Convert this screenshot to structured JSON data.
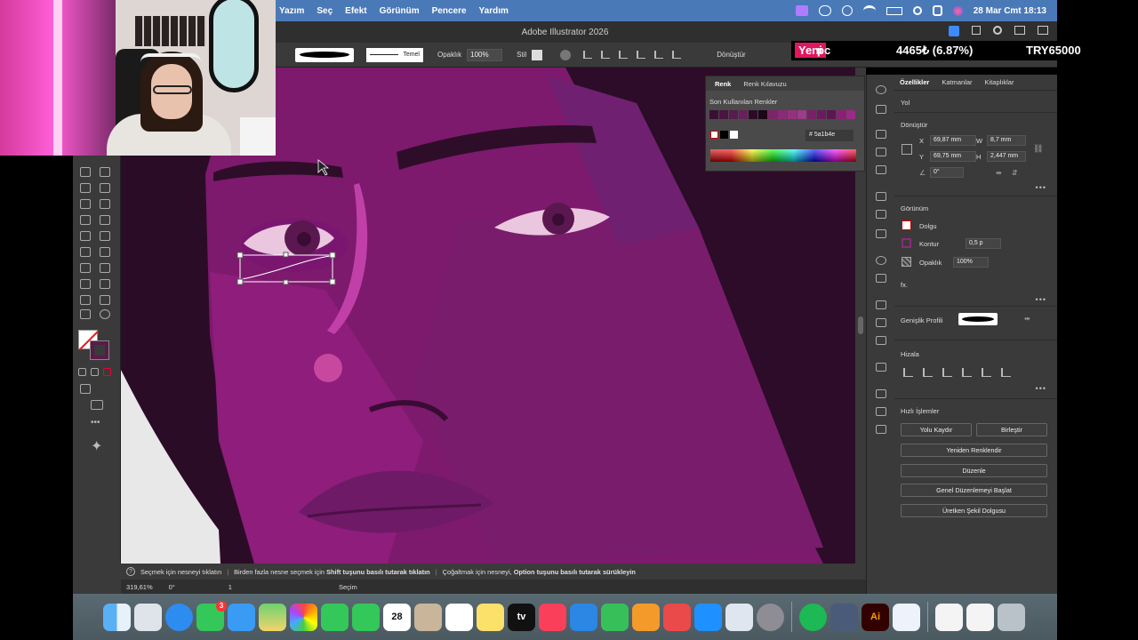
{
  "menubar": {
    "items": [
      "Yazım",
      "Seç",
      "Efekt",
      "Görünüm",
      "Pencere",
      "Yardım"
    ],
    "datetime": "28 Mar Cmt  18:13"
  },
  "titlebar": {
    "title": "Adobe Illustrator 2026"
  },
  "controlbar": {
    "stroke_profile": "Temel",
    "opacity_label": "Opaklık",
    "opacity_value": "100%",
    "style_label": "Stil",
    "transform_label": "Dönüştür"
  },
  "renk_panel": {
    "tab_renk": "Renk",
    "tab_guide": "Renk Kılavuzu",
    "recent_label": "Son Kullanılan Renkler",
    "hex_value": "5a1b4e",
    "recent_swatches": [
      "#3a0f33",
      "#4a1440",
      "#5a1b4e",
      "#6a1f5c",
      "#2c0b27",
      "#1a0717",
      "#7a2568",
      "#8b2b78",
      "#94327f",
      "#a03a8a",
      "#7b1f6b",
      "#6b1a5e",
      "#5c1752",
      "#8a1f78",
      "#9b2a88"
    ]
  },
  "properties": {
    "tabs": [
      "Özellikler",
      "Katmanlar",
      "Kitaplıklar"
    ],
    "object_type": "Yol",
    "transform": {
      "title": "Dönüştür",
      "x_label": "X",
      "x_value": "69,87 mm",
      "y_label": "Y",
      "y_value": "69,75 mm",
      "w_label": "W",
      "w_value": "8,7 mm",
      "h_label": "H",
      "h_value": "2,447 mm",
      "angle_value": "0°"
    },
    "appearance": {
      "title": "Görünüm",
      "fill_label": "Dolgu",
      "stroke_label": "Kontur",
      "stroke_value": "0,5 p",
      "opacity_label": "Opaklık",
      "opacity_value": "100%",
      "fx_label": "fx."
    },
    "width_profile_label": "Genişlik Profili",
    "align_title": "Hizala",
    "quick_actions_title": "Hızlı İşlemler",
    "btn_outline": "Yolu Kaydır",
    "btn_join": "Birleştir",
    "btn_recolor": "Yeniden Renklendir",
    "btn_arrange": "Düzenle",
    "btn_global_edit": "Genel Düzenlemeyi Başlat",
    "btn_generative": "Üretken Şekil Dolgusu"
  },
  "hintbar": {
    "part1": "Seçmek için nesneyi tıklatın",
    "part2": "Birden fazla nesne seçmek için",
    "key1": "Shift tuşunu basılı tutarak tıklatın",
    "part3": "Çoğaltmak için nesneyi,",
    "key2": "Option tuşunu basılı tutarak sürükleyin"
  },
  "statusbar": {
    "zoom": "319,61%",
    "rotation": "0°",
    "artboard": "1",
    "tool": "Seçim"
  },
  "dock": {
    "calendar_day": "28",
    "messages_badge": "3",
    "apps": [
      "finder-icon",
      "launchpad-icon",
      "safari-icon",
      "messages-icon",
      "mail-icon",
      "maps-icon",
      "photos-icon",
      "facetime-icon",
      "phone-icon",
      "calendar-icon",
      "contacts-icon",
      "reminders-icon",
      "notes-icon",
      "tv-icon",
      "music-icon",
      "keynote-icon",
      "numbers-icon",
      "pages-icon",
      "rocket-icon",
      "app-store-icon",
      "preview-icon",
      "settings-icon",
      "spotify-icon",
      "finder2-icon",
      "illustrator-icon",
      "vpn-icon",
      "document-icon",
      "screenshot-icon",
      "trash-icon"
    ],
    "illustrator_label": "Ai",
    "tv_label": "tv"
  },
  "overlay": {
    "badge_highlight": "Yeni",
    "badge_rest": "pc",
    "price": "4465₺ (6.87%)",
    "target": "TRY65000"
  },
  "colors": {
    "canvas_base": "#8b1b78",
    "accent_blue": "#4a79b8",
    "overlay_pink": "#e2165e"
  }
}
